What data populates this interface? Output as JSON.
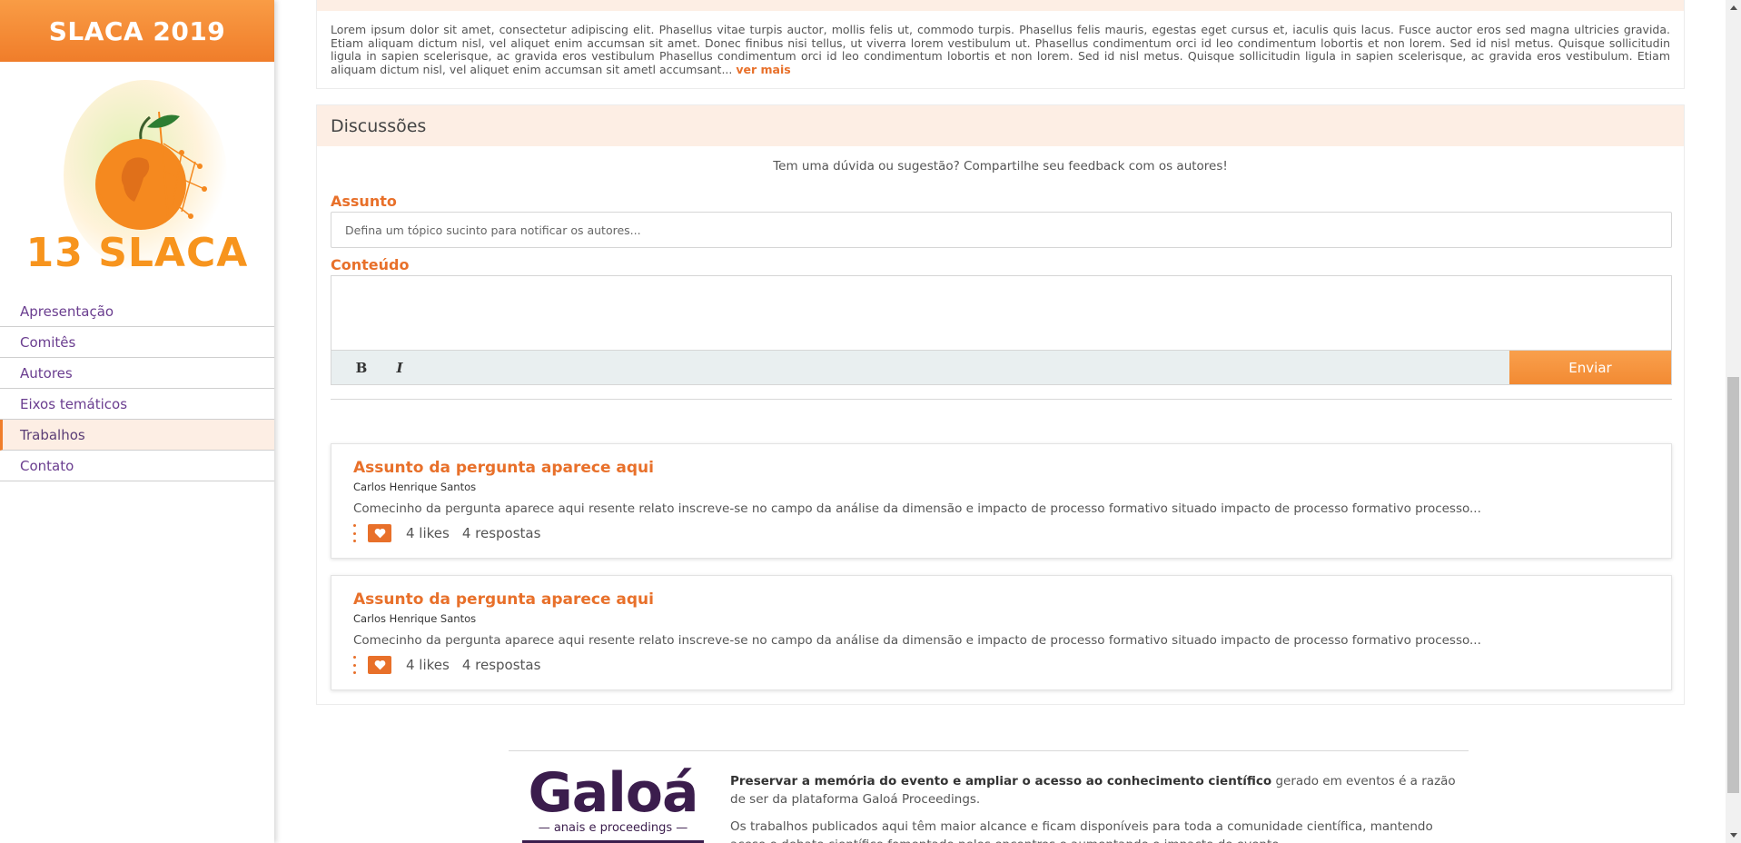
{
  "sidebar": {
    "header_title": "SLACA 2019",
    "logo_text": "13 SLACA",
    "nav": [
      {
        "label": "Apresentação"
      },
      {
        "label": "Comitês"
      },
      {
        "label": "Autores"
      },
      {
        "label": "Eixos temáticos"
      },
      {
        "label": "Trabalhos",
        "active": true
      },
      {
        "label": "Contato"
      }
    ]
  },
  "abstract": {
    "text": "Lorem ipsum dolor sit amet, consectetur adipiscing elit. Phasellus vitae turpis auctor, mollis felis ut, commodo turpis. Phasellus felis mauris, egestas eget cursus et, iaculis quis lacus. Fusce auctor eros sed magna ultricies gravida. Etiam aliquam dictum nisl, vel aliquet enim accumsan sit amet. Donec finibus nisi tellus, ut viverra lorem vestibulum ut. Phasellus condimentum orci id leo condimentum lobortis et non lorem. Sed id nisl metus. Quisque sollicitudin ligula in sapien scelerisque, ac gravida eros vestibulum Phasellus condimentum orci id leo condimentum lobortis et non lorem. Sed id nisl metus. Quisque sollicitudin ligula in sapien scelerisque, ac gravida eros vestibulum. Etiam aliquam dictum nisl, vel aliquet enim accumsan sit ametl accumsant...",
    "more_link": "ver mais"
  },
  "discussions": {
    "title": "Discussões",
    "intro": "Tem uma dúvida ou sugestão? Compartilhe seu feedback com os autores!",
    "subject_label": "Assunto",
    "subject_placeholder": "Defina um tópico sucinto para notificar os autores...",
    "content_label": "Conteúdo",
    "bold_label": "B",
    "italic_label": "I",
    "send_label": "Enviar",
    "questions": [
      {
        "title": "Assunto da pergunta aparece aqui",
        "author": "Carlos Henrique Santos",
        "excerpt": "Comecinho da pergunta aparece aqui resente relato inscreve-se no campo da análise da dimensão e impacto de processo formativo situado impacto de processo formativo processo...",
        "likes": "4 likes",
        "replies": "4 respostas"
      },
      {
        "title": "Assunto da pergunta aparece aqui",
        "author": "Carlos Henrique Santos",
        "excerpt": "Comecinho da pergunta aparece aqui resente relato inscreve-se no campo da análise da dimensão e impacto de processo formativo situado impacto de processo formativo processo...",
        "likes": "4 likes",
        "replies": "4 respostas"
      }
    ]
  },
  "footer": {
    "logo_word": "Galoá",
    "logo_sub": "— anais e proceedings —",
    "p1_bold": "Preservar a memória do evento e ampliar o acesso ao conhecimento científico",
    "p1_rest": " gerado em eventos é a razão de ser da plataforma Galoá Proceedings.",
    "p2": "Os trabalhos publicados aqui têm maior alcance e ficam disponíveis para toda a comunidade científica, mantendo aceso o debate científico fomentado pelos encontros e aumentando o impacto do evento."
  },
  "colors": {
    "accent": "#e8702a",
    "header_orange": "#f7941d",
    "nav_purple": "#6a3d8f",
    "galoa_purple": "#3b1d4d",
    "section_bg": "#fdeee4"
  }
}
